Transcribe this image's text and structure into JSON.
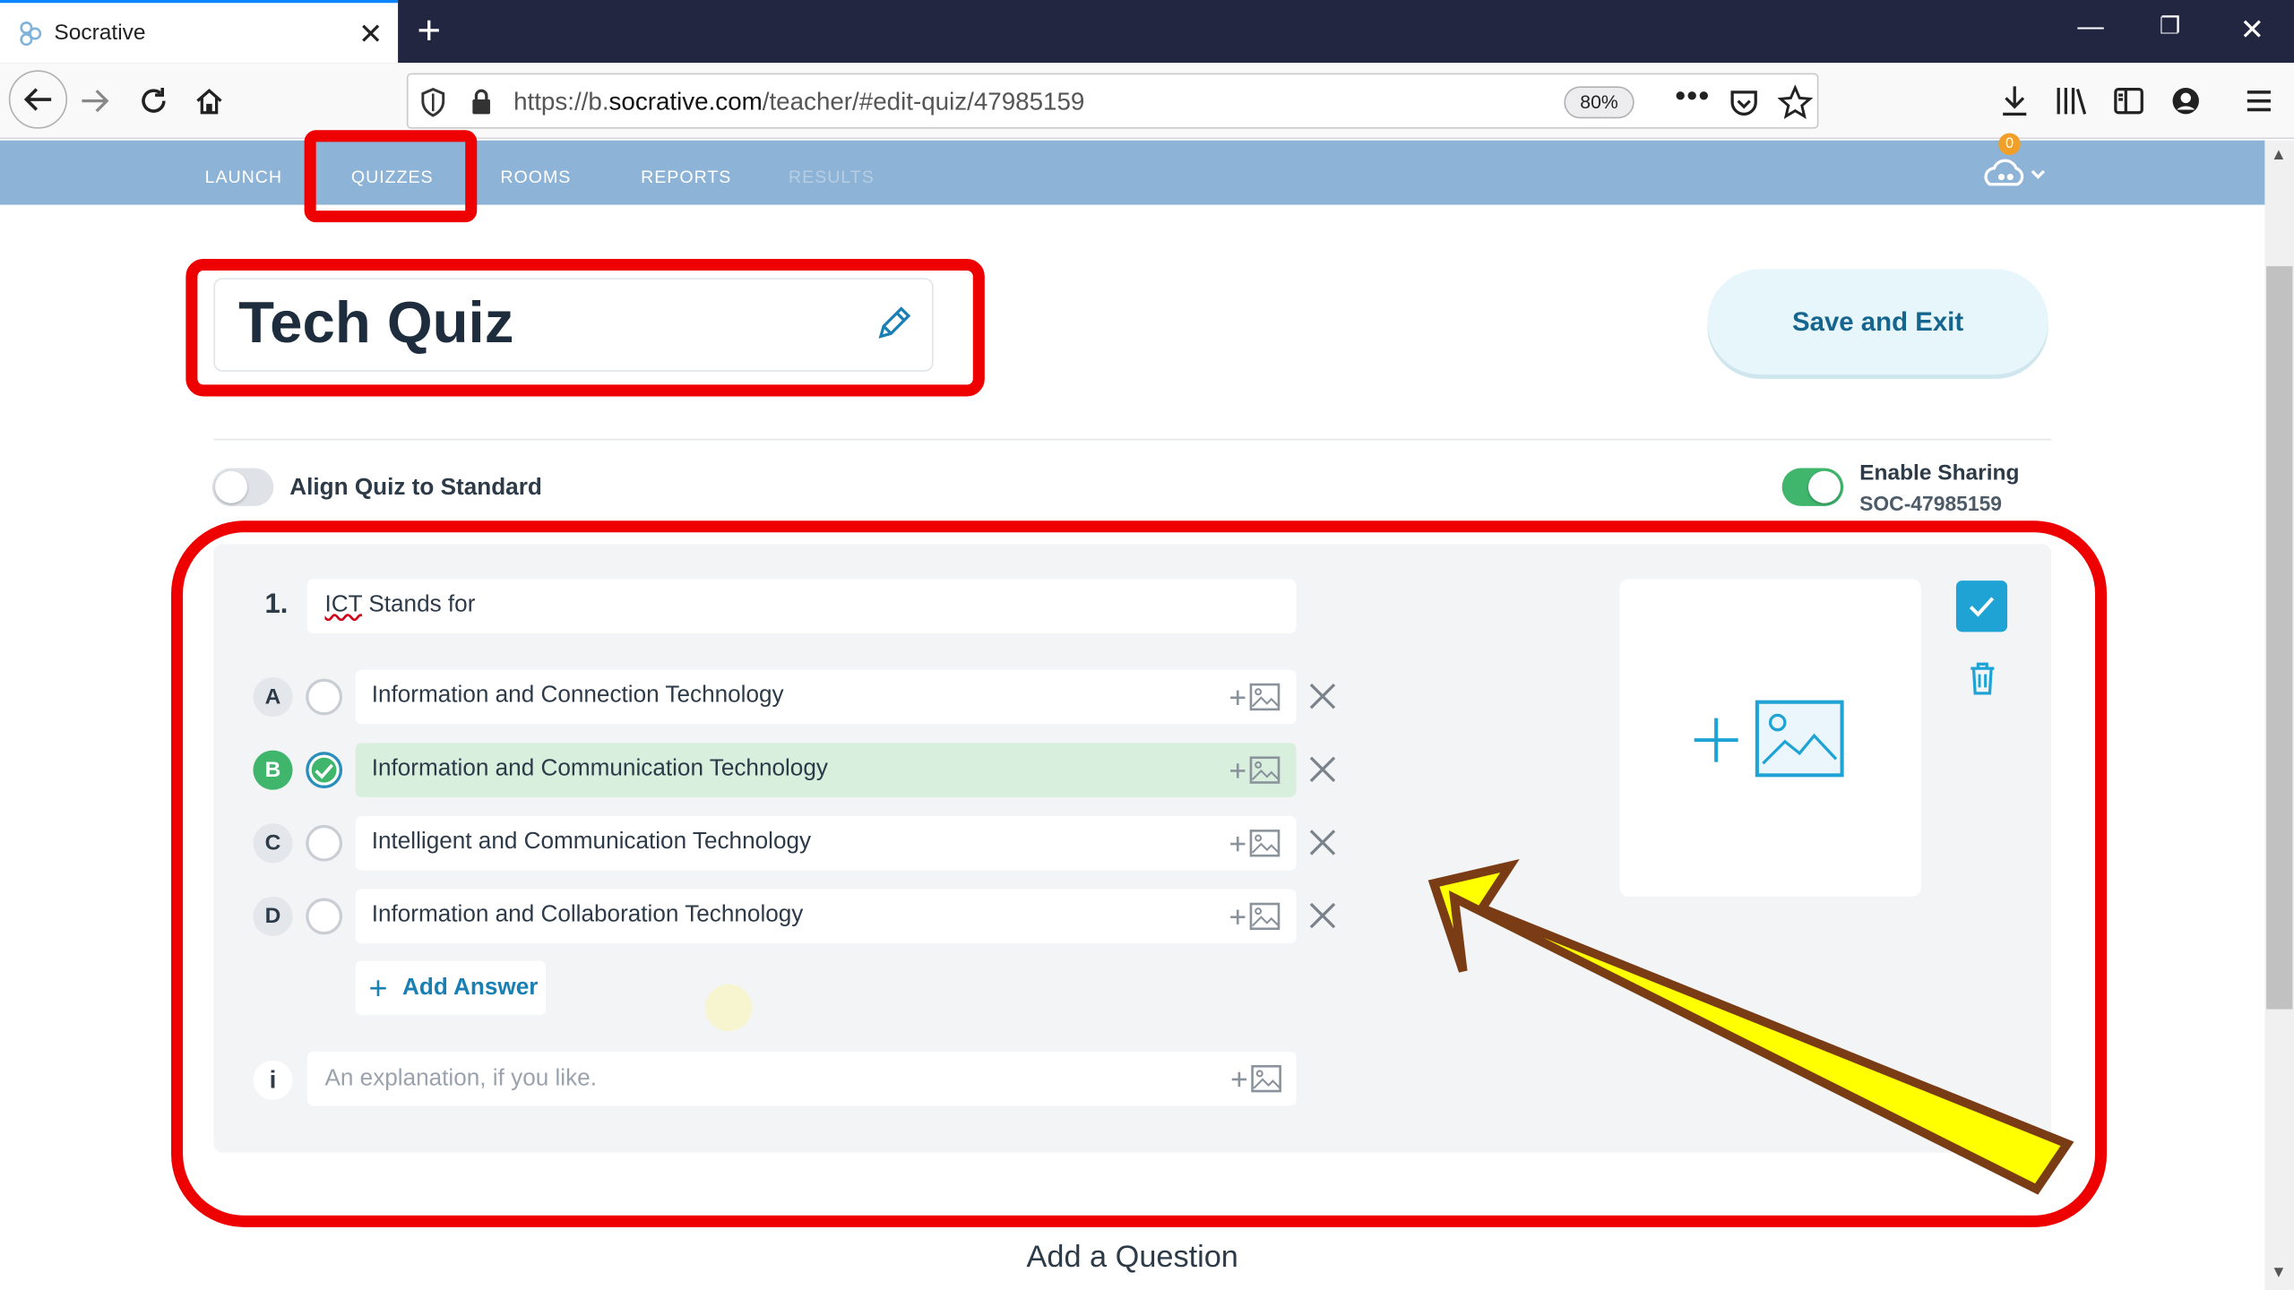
{
  "browser": {
    "tab_title": "Socrative",
    "url_prefix": "https://b.",
    "url_host": "socrative.com",
    "url_path": "/teacher/#edit-quiz/47985159",
    "zoom": "80%"
  },
  "appnav": {
    "items": [
      "LAUNCH",
      "QUIZZES",
      "ROOMS",
      "REPORTS",
      "RESULTS"
    ],
    "active": "QUIZZES",
    "disabled": "RESULTS",
    "notification_count": "0"
  },
  "quiz": {
    "title": "Tech Quiz",
    "save_label": "Save and Exit",
    "align_label": "Align Quiz to Standard",
    "align_enabled": false,
    "sharing_label": "Enable Sharing",
    "sharing_enabled": true,
    "sharing_code": "SOC-47985159"
  },
  "question": {
    "number": "1.",
    "text": "ICT Stands for",
    "answers": [
      {
        "letter": "A",
        "text": "Information and Connection Technology",
        "correct": false
      },
      {
        "letter": "B",
        "text": "Information and Communication Technology",
        "correct": true
      },
      {
        "letter": "C",
        "text": "Intelligent and Communication Technology",
        "correct": false
      },
      {
        "letter": "D",
        "text": "Information and Collaboration Technology",
        "correct": false
      }
    ],
    "add_answer_label": "Add Answer",
    "explanation_icon": "i",
    "explanation_placeholder": "An explanation, if you like."
  },
  "footer": {
    "add_question_label": "Add a Question"
  },
  "colors": {
    "appnav_bg": "#8db3d6",
    "accent": "#1fa3d5",
    "correct": "#3fb66c",
    "annotation_red": "#ee0000",
    "annotation_arrow": "#ffff00"
  }
}
